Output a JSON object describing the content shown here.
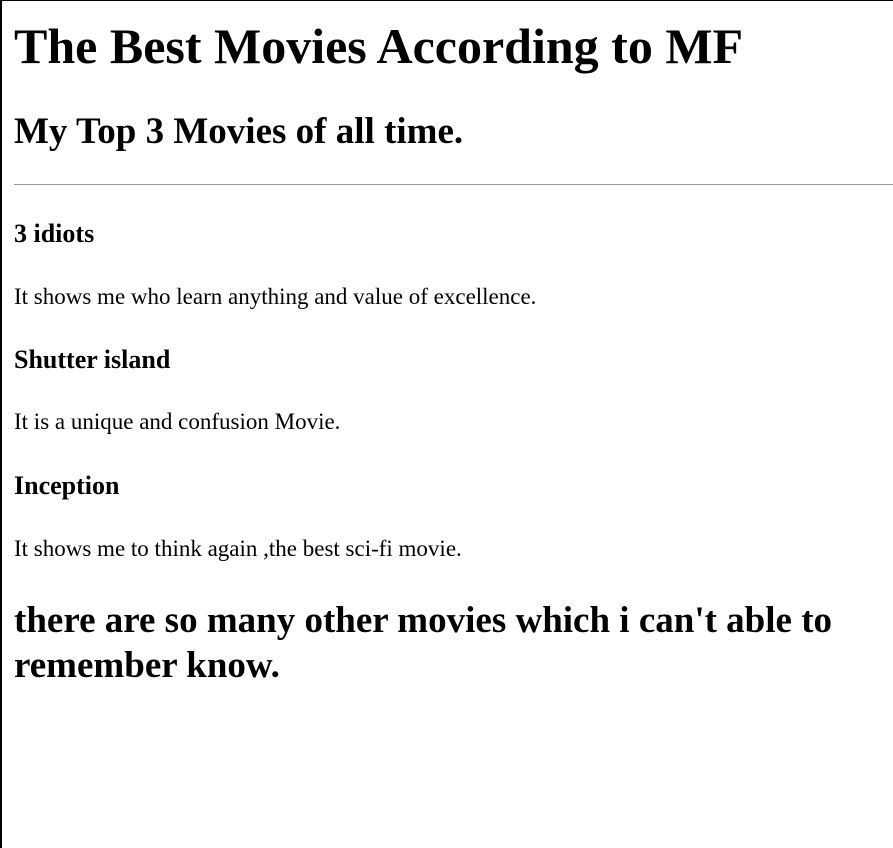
{
  "page": {
    "title": "The Best Movies According to MF",
    "subtitle": "My Top 3 Movies of all time."
  },
  "movies": [
    {
      "title": "3 idiots",
      "description": "It shows me who learn anything and value of excellence."
    },
    {
      "title": "Shutter island",
      "description": "It is a unique and confusion Movie."
    },
    {
      "title": "Inception",
      "description": "It shows me to think again ,the best sci-fi movie."
    }
  ],
  "closing": "there are so many other movies which i can't able to remember know."
}
